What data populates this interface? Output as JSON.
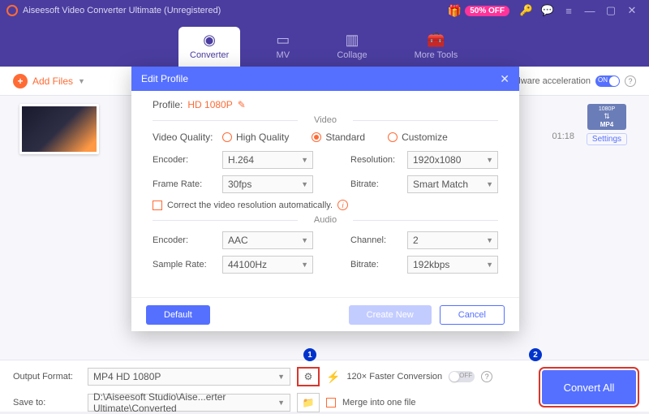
{
  "titlebar": {
    "app_title": "Aiseesoft Video Converter Ultimate (Unregistered)",
    "discount": "50% OFF"
  },
  "tabs": [
    {
      "label": "Converter",
      "icon": "◉"
    },
    {
      "label": "MV",
      "icon": "▭"
    },
    {
      "label": "Collage",
      "icon": "▥"
    },
    {
      "label": "More Tools",
      "icon": "🧰"
    }
  ],
  "toolbar": {
    "add_files": "Add Files",
    "hw_accel": "rdware acceleration"
  },
  "item": {
    "duration": "01:18",
    "format_res": "1080P",
    "format_ext": "MP4",
    "settings_link": "Settings"
  },
  "bottom": {
    "output_format_label": "Output Format:",
    "output_format_value": "MP4 HD 1080P",
    "faster": "120× Faster Conversion",
    "save_to_label": "Save to:",
    "save_to_value": "D:\\Aiseesoft Studio\\Aise...erter Ultimate\\Converted",
    "merge": "Merge into one file",
    "convert_all": "Convert All"
  },
  "modal": {
    "title": "Edit Profile",
    "profile_label": "Profile:",
    "profile_value": "HD 1080P",
    "video_section": "Video",
    "audio_section": "Audio",
    "quality_label": "Video Quality:",
    "quality_opts": {
      "high": "High Quality",
      "standard": "Standard",
      "custom": "Customize"
    },
    "video": {
      "encoder_label": "Encoder:",
      "encoder": "H.264",
      "resolution_label": "Resolution:",
      "resolution": "1920x1080",
      "framerate_label": "Frame Rate:",
      "framerate": "30fps",
      "bitrate_label": "Bitrate:",
      "bitrate": "Smart Match"
    },
    "correct": "Correct the video resolution automatically.",
    "audio": {
      "encoder_label": "Encoder:",
      "encoder": "AAC",
      "channel_label": "Channel:",
      "channel": "2",
      "samplerate_label": "Sample Rate:",
      "samplerate": "44100Hz",
      "bitrate_label": "Bitrate:",
      "bitrate": "192kbps"
    },
    "buttons": {
      "default": "Default",
      "create": "Create New",
      "cancel": "Cancel"
    }
  }
}
